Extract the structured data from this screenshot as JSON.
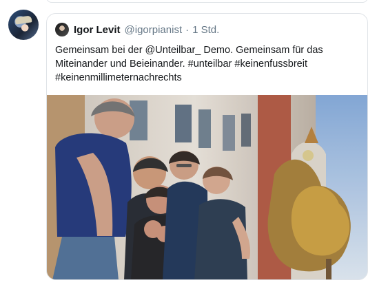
{
  "outer_tweet": {
    "avatar_icon": "profile-avatar"
  },
  "quoted_tweet": {
    "author_name": "Igor Levit",
    "author_handle": "@igorpianist",
    "separator": "·",
    "timestamp": "1 Std.",
    "text": "Gemeinsam bei der @Unteilbar_ Demo. Gemeinsam für das Miteinander und Beieinander. #unteilbar #keinenfussbreit #keinenmillimeternachrechts",
    "media_icon": "photo-media"
  },
  "colors": {
    "border": "#dfe3e7",
    "secondary_text": "#657786",
    "primary_text": "#14171a"
  }
}
